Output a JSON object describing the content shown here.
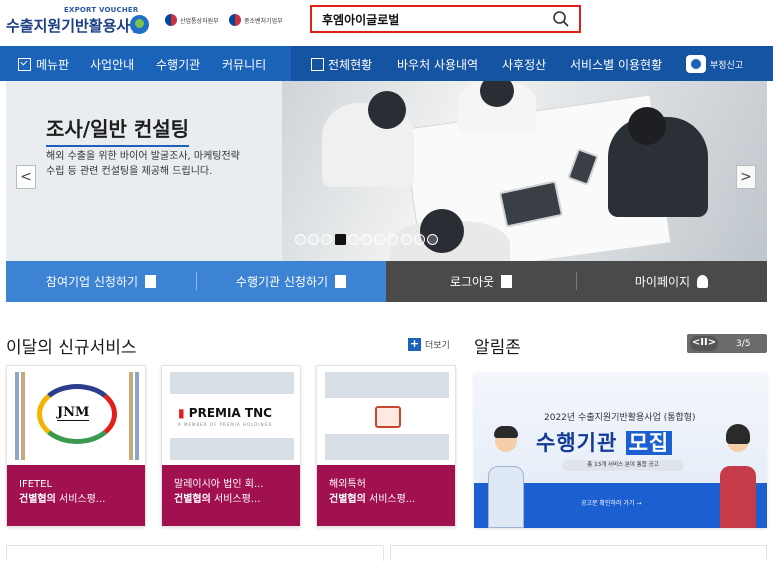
{
  "header": {
    "logo_sub": "EXPORT VOUCHER",
    "logo_main": "수출지원기반활용사업",
    "ministry_1": "산업통상자원부",
    "ministry_2": "중소벤처기업부",
    "search_value": "후엠아이글로벌",
    "search_icon": "magnifier"
  },
  "nav": {
    "menu_label": "메뉴판",
    "items": [
      "사업안내",
      "수행기관",
      "커뮤니티"
    ],
    "stat_label": "전체현황",
    "dark_items": [
      "바우처 사용내역",
      "사후정산",
      "서비스별 이용현황"
    ],
    "report_label": "부정신고"
  },
  "banner": {
    "title": "조사/일반 컨설팅",
    "desc": "해외 수출을 위한 바이어 발굴조사, 마케팅전략 수립 등 관련 컨설팅을 제공해 드립니다.",
    "prev_glyph": "<",
    "next_glyph": ">",
    "slide_count": 11,
    "active_slide": 4
  },
  "quick": {
    "apply_company": "참여기업 신청하기",
    "apply_agency": "수행기관 신청하기",
    "logout": "로그아웃",
    "mypage": "마이페이지"
  },
  "services": {
    "title": "이달의 신규서비스",
    "more_label": "더보기",
    "cards": [
      {
        "name": "IFETEL",
        "sub_bold": "건별협의",
        "sub_rest": " 서비스평...",
        "logo_text": "JNM"
      },
      {
        "name": "말레이시아 법인 회...",
        "sub_bold": "건별협의",
        "sub_rest": " 서비스평...",
        "logo_text_red": "▮",
        "logo_text": "PREMIA TNC",
        "logo_tag": "A MEMBER OF PREMIA HOLDINGS"
      },
      {
        "name": "해외특허",
        "sub_bold": "건별협의",
        "sub_rest": " 서비스평..."
      }
    ]
  },
  "notice": {
    "title": "알림존",
    "pager_ctrl": "<II>",
    "pager_count": "3/5",
    "banner_year": "2022년 수출지원기반활용사업 (통합형)",
    "banner_main_1": "수행기관",
    "banner_main_2": "모집",
    "banner_sub": "총 13개 서비스 분야 통합 공고",
    "banner_cta": "공고문 확인하러 가기 →"
  },
  "colors": {
    "nav_blue": "#1b63b9",
    "nav_dark_blue": "#1553a3",
    "quick_blue": "#3d83d3",
    "quick_dark": "#4a4a4a",
    "card_magenta": "#a2114f",
    "search_border": "#e1201a"
  }
}
